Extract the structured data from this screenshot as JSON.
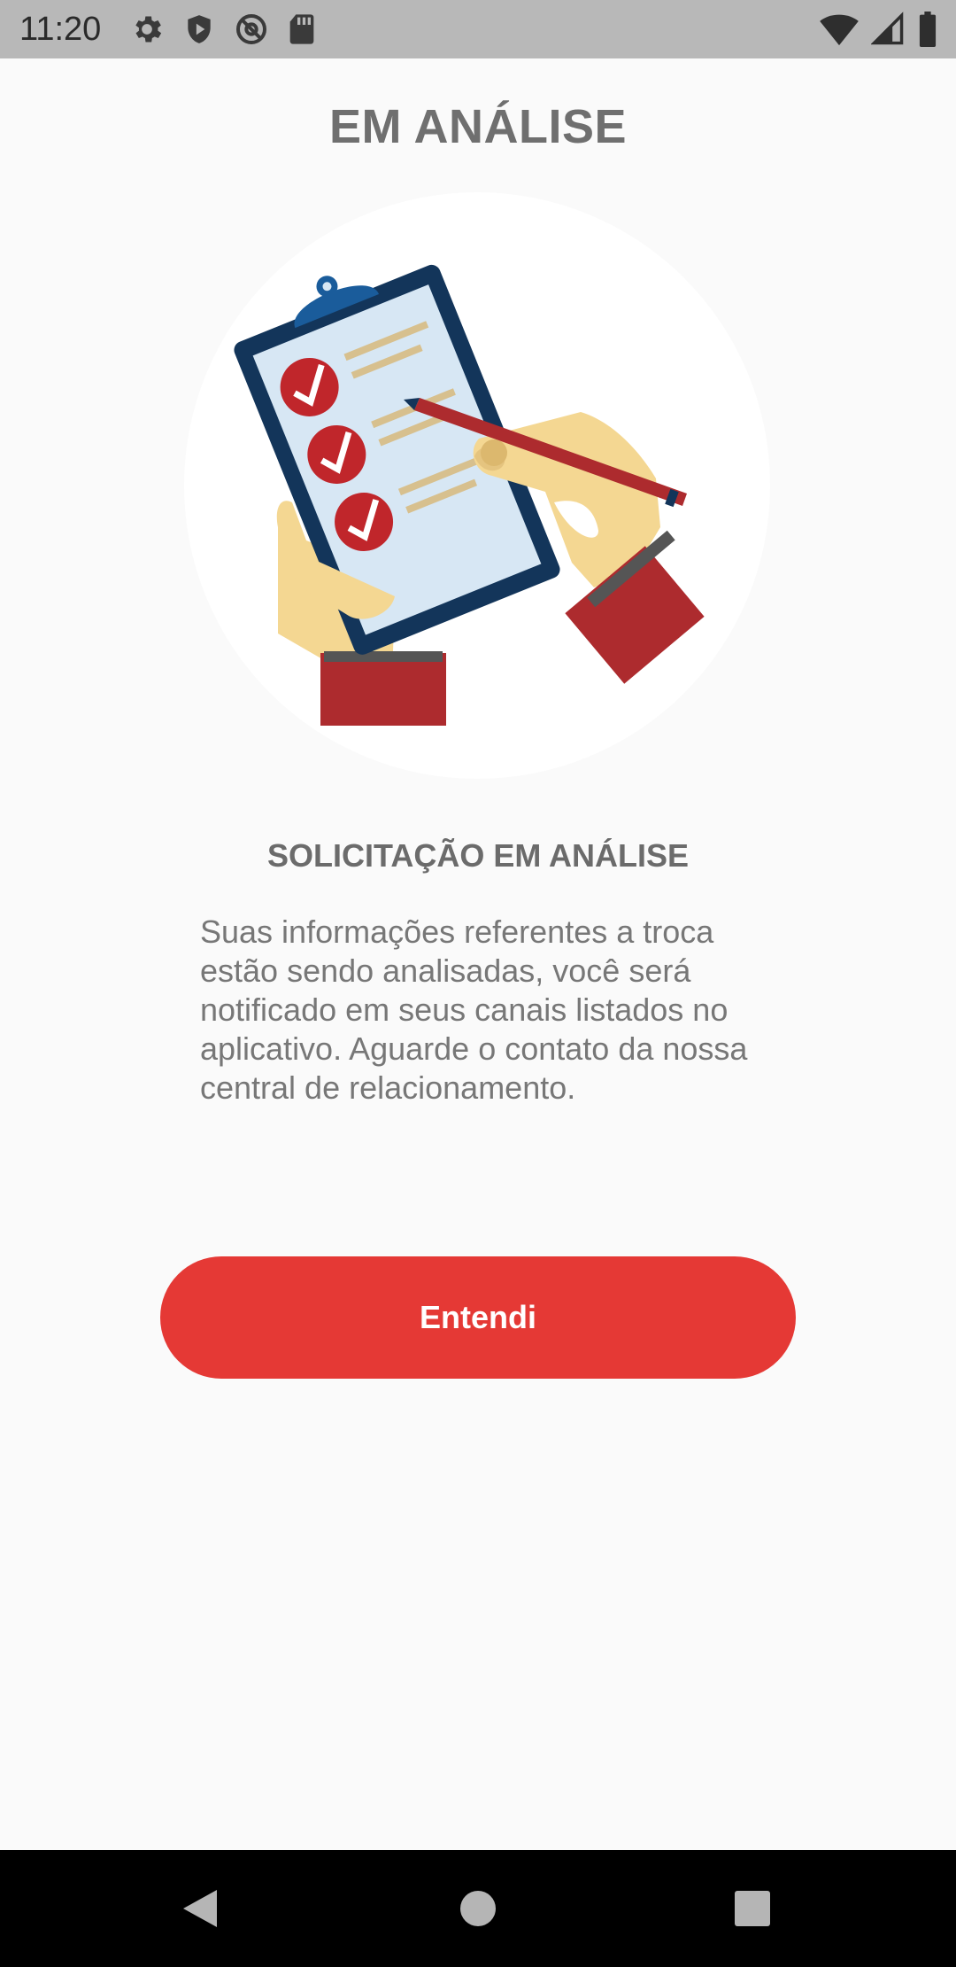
{
  "status_bar": {
    "time": "11:20",
    "left_icons": [
      "settings-icon",
      "shield-icon",
      "at-sign-icon",
      "sd-card-icon"
    ],
    "right_icons": [
      "wifi-icon",
      "cell-signal-icon",
      "battery-icon"
    ]
  },
  "screen": {
    "title": "EM ANÁLISE",
    "illustration": "clipboard-checklist-illustration",
    "heading": "SOLICITAÇÃO EM ANÁLISE",
    "description": "Suas informações referentes a troca estão sendo analisadas, você será notificado em seus canais listados no aplicativo. Aguarde o contato da nossa central de relacionamento.",
    "button_label": "Entendi"
  },
  "colors": {
    "accent": "#e53935",
    "title_text": "#6f6f6f",
    "body_text": "#777777",
    "background": "#fafafa"
  },
  "nav_bar": {
    "buttons": [
      "back-icon",
      "home-icon",
      "recents-icon"
    ]
  }
}
